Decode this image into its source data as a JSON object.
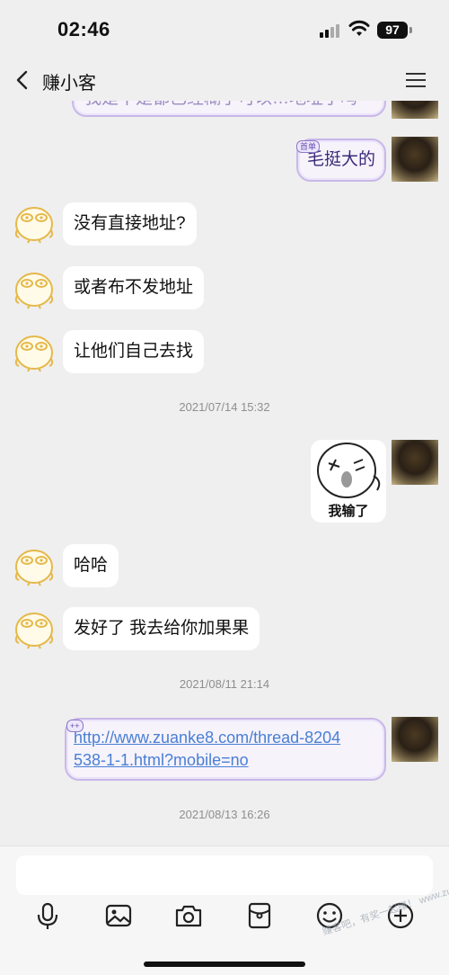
{
  "status_bar": {
    "time": "02:46",
    "battery": "97"
  },
  "nav": {
    "title": "赚小客"
  },
  "messages": {
    "partial_top": "我是不是都已经糊了可以…地址了吗",
    "user_1": {
      "badge": "首单",
      "text": "毛挺大的"
    },
    "bot_1": "没有直接地址?",
    "bot_2": "或者布不发地址",
    "bot_3": "让他们自己去找",
    "time_1": "2021/07/14 15:32",
    "sticker_caption": "我输了",
    "bot_4": "哈哈",
    "bot_5": "发好了 我去给你加果果",
    "time_2": "2021/08/11 21:14",
    "user_link": {
      "badge": "++",
      "line1": "http://www.zuanke8.com/thread-8204",
      "line2": "538-1-1.html?mobile=no"
    },
    "time_3": "2021/08/13 16:26"
  },
  "input": {
    "placeholder": ""
  },
  "toolbar": {
    "icons": [
      "microphone-icon",
      "image-icon",
      "camera-icon",
      "red-packet-icon",
      "emoji-icon",
      "plus-icon"
    ]
  },
  "watermark": "赚客吧，有奖一起赚！ www.zuanke8"
}
